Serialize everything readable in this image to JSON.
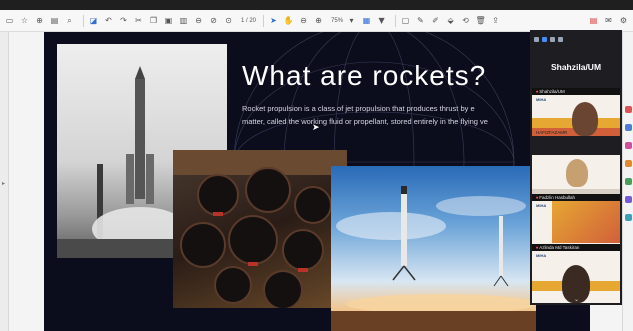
{
  "toolbar": {
    "page_indicator": "1 / 20",
    "zoom": "75%",
    "icons": [
      "page-icon",
      "star-icon",
      "upload-icon",
      "print-icon",
      "search-icon",
      "pointer-icon",
      "undo-icon",
      "redo-icon",
      "cut-icon",
      "copy-icon",
      "paste-icon",
      "delete-icon",
      "first-page-icon",
      "prev-page-icon",
      "next-page-icon",
      "last-page-icon",
      "select-icon",
      "hand-icon",
      "zoom-in-icon",
      "zoom-out-icon",
      "fit-page-icon",
      "highlight-icon",
      "comment-icon",
      "sign-icon",
      "draw-icon",
      "stamp-icon",
      "undo-annotation-icon",
      "trash-icon",
      "share-icon",
      "pdf-icon",
      "mail-icon",
      "settings-icon"
    ]
  },
  "slide": {
    "title": "What are rockets?",
    "body_line_1": "Rocket propulsion is a class of jet propulsion that produces thrust by e",
    "body_line_2": "matter, called the working fluid or propellant, stored entirely in the flying ve"
  },
  "meeting": {
    "active_speaker": "Shahzila/UM",
    "participants": [
      {
        "name": "Shahzila/UM",
        "logo": "MIHA"
      },
      {
        "name": "HAFIZFAZAMR",
        "logo": ""
      },
      {
        "name": "Fadzlin Hasbullah",
        "logo": "MIHA"
      },
      {
        "name": "Azlinda Md Taskiran",
        "logo": "MIHA"
      }
    ]
  },
  "colors": {
    "slide_bg": "#0c0d1c",
    "toolbar_bg": "#f7f7f7",
    "sidebar_bg": "#1d1d22",
    "accent_blue": "#2f6fd1",
    "mic_muted": "#ff4a4a"
  }
}
